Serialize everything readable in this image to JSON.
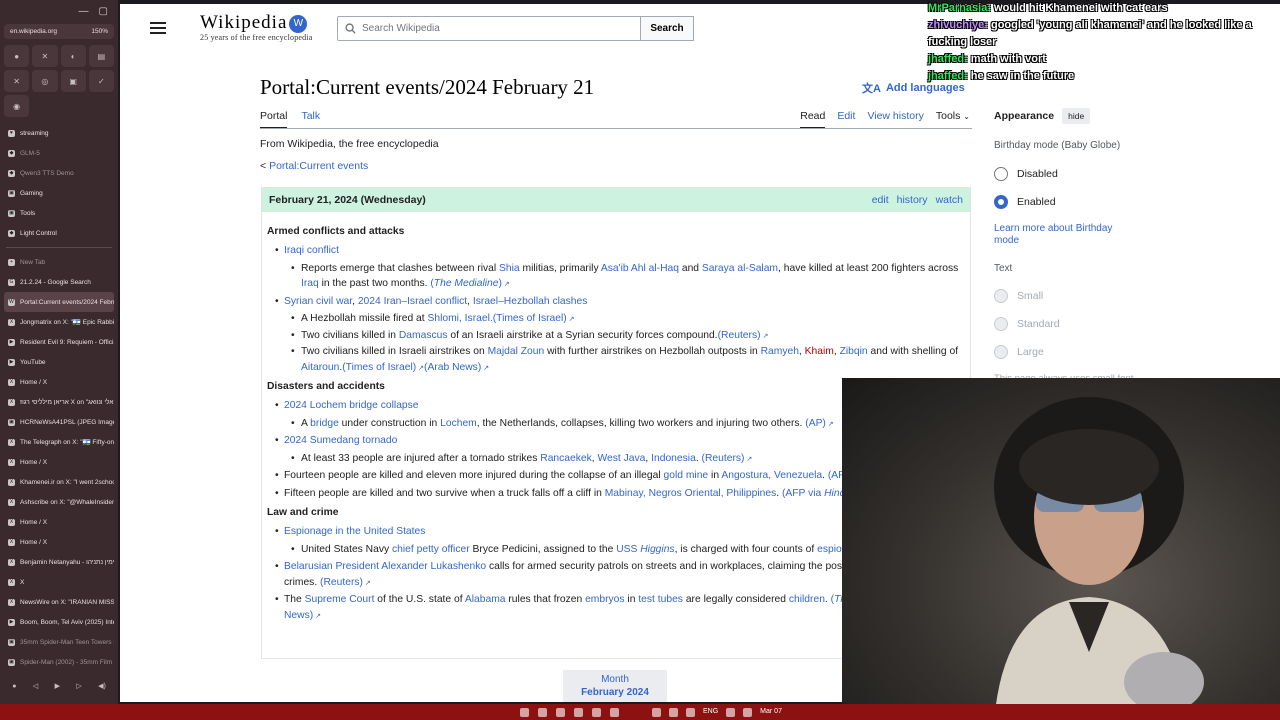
{
  "browser": {
    "url": "en.wikipedia.org",
    "zoom": "150%",
    "pinned": [
      "●",
      "✕",
      "◐",
      "▤",
      "✕",
      "◎",
      "▣",
      "✓",
      "◉"
    ],
    "sidebar_items": [
      {
        "label": "streaming",
        "icon": "♥",
        "style": "normal"
      },
      {
        "label": "GLM-5",
        "icon": "◆",
        "style": "dim"
      },
      {
        "label": "Qwen3 TTS Demo",
        "icon": "◆",
        "style": "dim"
      },
      {
        "label": "Gaming",
        "icon": "▣",
        "style": "normal"
      },
      {
        "label": "Tools",
        "icon": "▣",
        "style": "normal"
      },
      {
        "label": "Light Control",
        "icon": "◆",
        "style": "normal"
      },
      {
        "label": "New Tab",
        "icon": "+",
        "style": "dim"
      },
      {
        "label": "21.2.24 - Google Search",
        "icon": "G",
        "style": "normal"
      },
      {
        "label": "Portal:Current events/2024 Februa",
        "icon": "W",
        "style": "active"
      },
      {
        "label": "Jongmatrix on X: \"🇮🇱 Epic Rabbi C",
        "icon": "X",
        "style": "normal"
      },
      {
        "label": "Resident Evil 9: Requiem - Official",
        "icon": "▶",
        "style": "normal"
      },
      {
        "label": "YouTube",
        "icon": "▶",
        "style": "normal"
      },
      {
        "label": "Home / X",
        "icon": "X",
        "style": "normal"
      },
      {
        "label": "אריאן מילליסי רגוז X on \"אלי ונוואג",
        "icon": "X",
        "style": "normal"
      },
      {
        "label": "HCRNeWsA41PSL (JPEG Image,",
        "icon": "▣",
        "style": "normal"
      },
      {
        "label": "The Telegraph on X: \"🇮🇱 Fifty-one",
        "icon": "X",
        "style": "normal"
      },
      {
        "label": "Home / X",
        "icon": "X",
        "style": "normal"
      },
      {
        "label": "Khamenei.ir on X: \"I went 2school",
        "icon": "X",
        "style": "normal"
      },
      {
        "label": "Ashscribe on X: \"@WhaleInsider G",
        "icon": "X",
        "style": "normal"
      },
      {
        "label": "Home / X",
        "icon": "X",
        "style": "normal"
      },
      {
        "label": "Home / X",
        "icon": "X",
        "style": "normal"
      },
      {
        "label": "Benjamin Netanyahu - בנימין נתניהו",
        "icon": "X",
        "style": "normal"
      },
      {
        "label": "X",
        "icon": "X",
        "style": "normal"
      },
      {
        "label": "NewsWire on X: \"IRANIAN MISSIL",
        "icon": "X",
        "style": "normal"
      },
      {
        "label": "Boom, Boom, Tel Aviv (2025) Inter",
        "icon": "▶",
        "style": "normal"
      },
      {
        "label": "35mm Spider-Man Teen Towers D",
        "icon": "▣",
        "style": "dim"
      },
      {
        "label": "Spider-Man (2002) - 35mm Film",
        "icon": "▣",
        "style": "dim"
      }
    ]
  },
  "wiki": {
    "logo_word": "Wikipedia",
    "logo_tagline": "25 years of the free encyclopedia",
    "search_placeholder": "Search Wikipedia",
    "search_button": "Search",
    "title": "Portal:Current events/2024 February 21",
    "add_languages": "Add languages",
    "tabs_left": [
      "Portal",
      "Talk"
    ],
    "tabs_right": [
      "Read",
      "Edit",
      "View history",
      "Tools"
    ],
    "from": "From Wikipedia, the free encyclopedia",
    "back_prefix": "< ",
    "back_link": "Portal:Current events",
    "day_header": "February 21, 2024 (Wednesday)",
    "head_links": [
      "edit",
      "history",
      "watch"
    ],
    "month_label": "Month",
    "month_value": "February 2024"
  },
  "appearance": {
    "title": "Appearance",
    "hide": "hide",
    "birthday_label": "Birthday mode (Baby Globe)",
    "birthday_options": [
      {
        "label": "Disabled",
        "checked": false
      },
      {
        "label": "Enabled",
        "checked": true
      }
    ],
    "learn_more": "Learn more about Birthday mode",
    "text_label": "Text",
    "text_options": [
      "Small",
      "Standard",
      "Large"
    ],
    "note": "This page always uses small font size"
  },
  "chat": [
    {
      "name": "MrParnasia",
      "text": "would hit Khamenei with cat ears",
      "color": "green"
    },
    {
      "name": "zhivuchiye",
      "text": "googled 'young ali khamenei' and he looked like a fucking loser",
      "color": "purple"
    },
    {
      "name": "jhaffed",
      "text": "math with vort",
      "color": "green"
    },
    {
      "name": "jhaffed",
      "text": "he saw in the future",
      "color": "green"
    }
  ],
  "taskbar": {
    "lang": "ENG",
    "date": "Mar 07"
  }
}
